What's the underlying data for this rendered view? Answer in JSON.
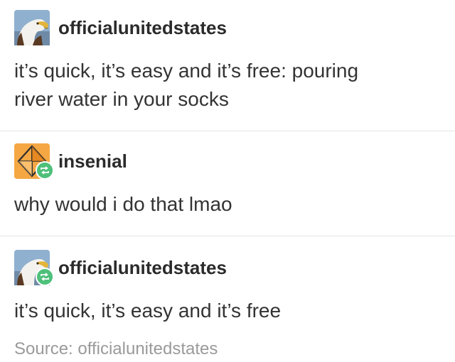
{
  "posts": [
    {
      "username": "officialunitedstates",
      "avatar": "eagle-avatar",
      "reblog": false,
      "lines": [
        "it’s quick, it’s easy and it’s free: pouring",
        "river water in your socks"
      ]
    },
    {
      "username": "insenial",
      "avatar": "orange-diamond-avatar",
      "reblog": true,
      "lines": [
        "why would i do that lmao"
      ]
    },
    {
      "username": "officialunitedstates",
      "avatar": "eagle-avatar",
      "reblog": true,
      "lines": [
        "it’s quick, it’s easy and it’s free"
      ]
    }
  ],
  "source": {
    "text": "Source: officialunitedstates"
  },
  "colors": {
    "reblog_badge": "#4ec07a",
    "divider": "#e6e6e6",
    "source_text": "#9a9a9a"
  }
}
